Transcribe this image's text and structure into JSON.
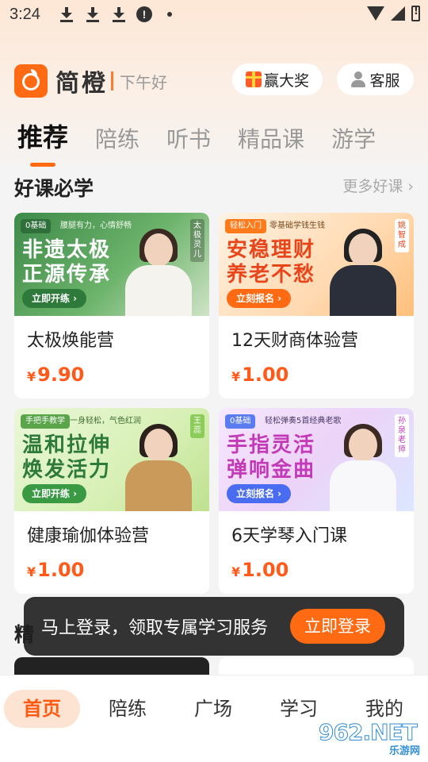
{
  "status_bar": {
    "time": "3:24",
    "warning_glyph": "!"
  },
  "header": {
    "brand": "简橙",
    "greeting": "下午好",
    "prize_label": "赢大奖",
    "service_label": "客服"
  },
  "tabs": [
    {
      "label": "推荐",
      "active": true
    },
    {
      "label": "陪练"
    },
    {
      "label": "听书"
    },
    {
      "label": "精品课"
    },
    {
      "label": "游学"
    }
  ],
  "section": {
    "title": "好课必学",
    "more": "更多好课 ›"
  },
  "courses": [
    {
      "title": "太极焕能营",
      "currency": "¥",
      "price": "9.90",
      "banner": {
        "tag": "0基础",
        "subtag": "腰腿有力，心情舒畅",
        "headline_1": "非遗太极",
        "headline_2": "正源传承",
        "cta": "立即开练 ›",
        "teacher": "太极灵儿"
      }
    },
    {
      "title": "12天财商体验营",
      "currency": "¥",
      "price": "1.00",
      "banner": {
        "tag": "轻松入门",
        "subtag": "零基础学钱生钱",
        "headline_1": "安稳理财",
        "headline_2": "养老不愁",
        "cta": "立刻报名 ›",
        "teacher": "姚智成"
      }
    },
    {
      "title": "健康瑜伽体验营",
      "currency": "¥",
      "price": "1.00",
      "banner": {
        "tag": "手把手教学",
        "subtag": "一身轻松，气色红润",
        "headline_1": "温和拉伸",
        "headline_2": "焕发活力",
        "cta": "立即开练 ›",
        "teacher": "王蕊"
      }
    },
    {
      "title": "6天学琴入门课",
      "currency": "¥",
      "price": "1.00",
      "banner": {
        "tag": "0基础",
        "subtag": "轻松弹奏5首经典老歌",
        "headline_1": "手指灵活",
        "headline_2": "弹响金曲",
        "cta": "立刻报名 ›",
        "teacher": "孙泉老师"
      }
    }
  ],
  "next_section_peek": "精",
  "toast": {
    "text": "马上登录，领取专属学习服务",
    "button": "立即登录"
  },
  "bottom_nav": [
    {
      "label": "首页",
      "active": true
    },
    {
      "label": "陪练"
    },
    {
      "label": "广场"
    },
    {
      "label": "学习"
    },
    {
      "label": "我的"
    }
  ],
  "watermark": {
    "text": "962.NET",
    "sub": "乐游网"
  },
  "colors": {
    "accent": "#ff6a13",
    "price": "#ff5a1a"
  }
}
